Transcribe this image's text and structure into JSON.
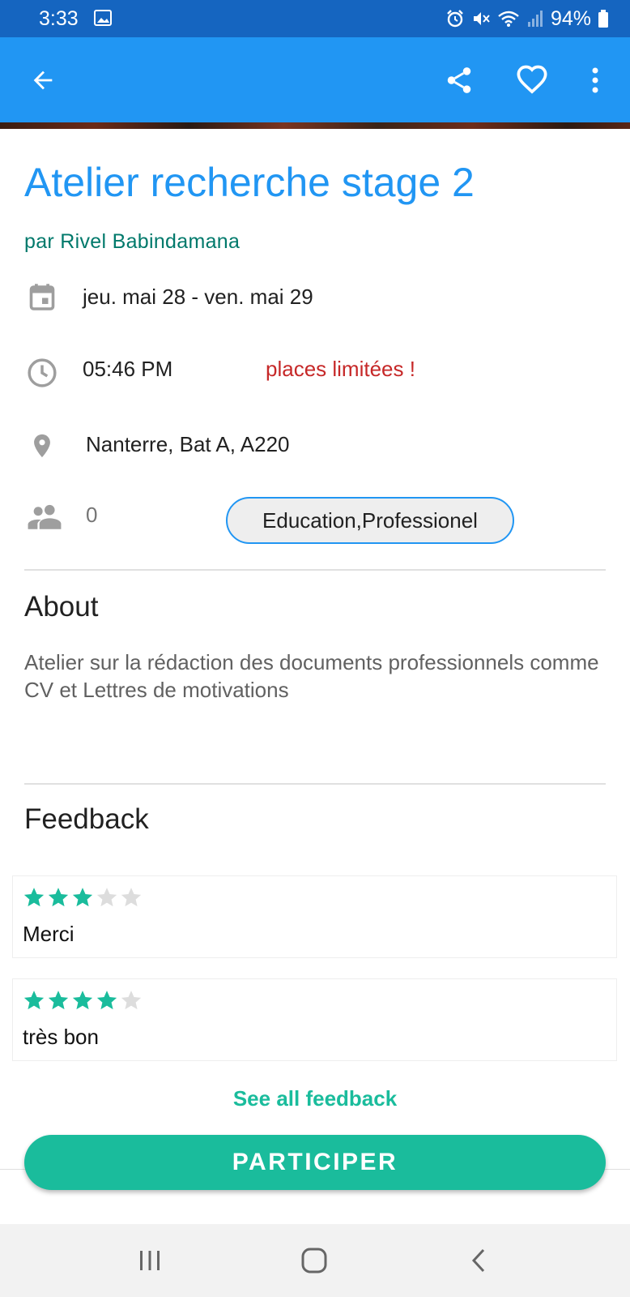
{
  "status_bar": {
    "time": "3:33",
    "battery_percent": "94%",
    "icons": [
      "gallery-icon",
      "alarm-icon",
      "mute-icon",
      "wifi-icon",
      "signal-icon",
      "battery-icon"
    ]
  },
  "app_bar": {
    "back_icon": "arrow-back-icon",
    "share_icon": "share-icon",
    "favorite_icon": "heart-outline-icon",
    "more_icon": "more-vert-icon",
    "color": "#2196f3"
  },
  "event": {
    "title": "Atelier recherche stage 2",
    "author": "par Rivel Babindamana",
    "dates": "jeu. mai 28  -  ven. mai 29",
    "time": "05:46 PM",
    "limited": "places limitées !",
    "location": "Nanterre, Bat A, A220",
    "participants": "0",
    "category": "Education,Professionel"
  },
  "about": {
    "heading": "About",
    "text": "Atelier sur la rédaction des documents professionnels comme CV et Lettres de motivations"
  },
  "feedback": {
    "heading": "Feedback",
    "items": [
      {
        "rating": 3,
        "max": 5,
        "text": "Merci"
      },
      {
        "rating": 4,
        "max": 5,
        "text": "très bon"
      }
    ],
    "see_all": "See all feedback"
  },
  "participate_label": "PARTICIPER",
  "colors": {
    "accent": "#1abc9c",
    "primary": "#2196f3",
    "status_bar": "#1565c0",
    "warning": "#c62828",
    "author": "#00796b"
  }
}
